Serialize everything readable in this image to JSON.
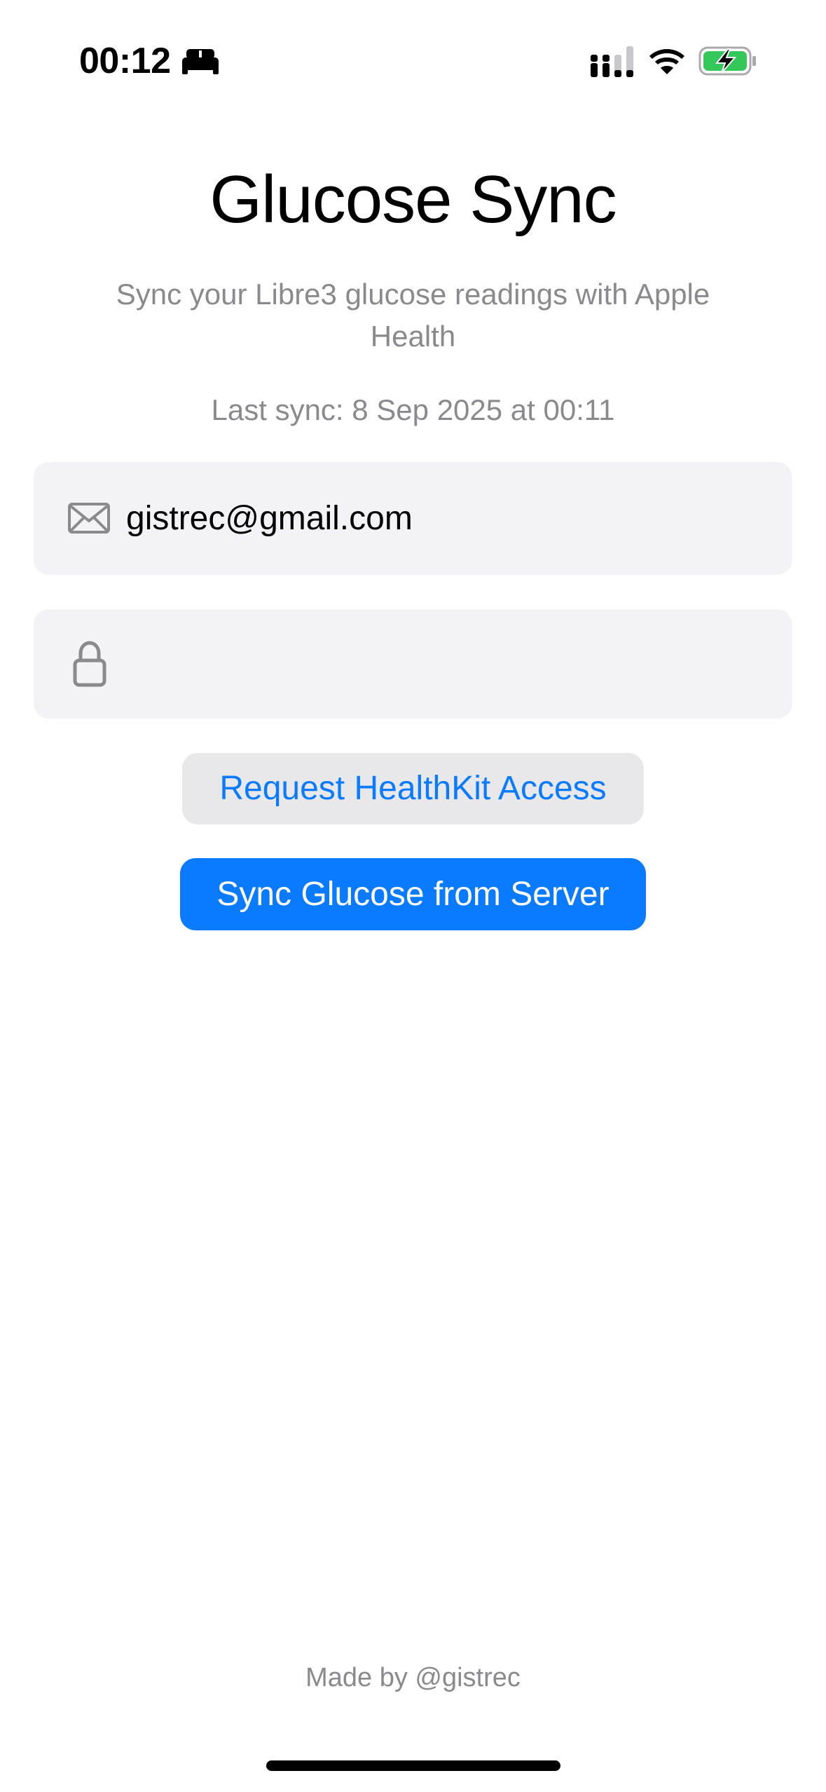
{
  "status_bar": {
    "time": "00:12",
    "focus_icon": "bed-icon",
    "signal_icon": "cellular-signal-icon",
    "wifi_icon": "wifi-icon",
    "battery_icon": "battery-charging-icon",
    "battery_color": "#34c759"
  },
  "header": {
    "title": "Glucose Sync",
    "subtitle": "Sync your Libre3 glucose readings with Apple Health",
    "last_sync": "Last sync: 8 Sep 2025 at 00:11"
  },
  "form": {
    "email": {
      "icon": "envelope-icon",
      "value": "gistrec@gmail.com",
      "placeholder": ""
    },
    "password": {
      "icon": "lock-icon",
      "value": "",
      "placeholder": ""
    }
  },
  "actions": {
    "healthkit_label": "Request HealthKit Access",
    "sync_label": "Sync Glucose from Server"
  },
  "footer": {
    "credit": "Made by @gistrec"
  },
  "colors": {
    "accent": "#0a7aff",
    "field_background": "#f2f2f7",
    "secondary_text": "#8a8a8e"
  }
}
